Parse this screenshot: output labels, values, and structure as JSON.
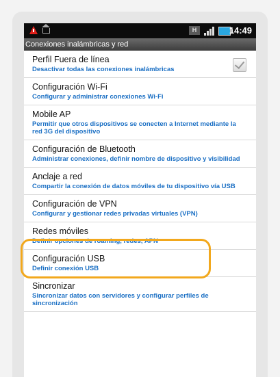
{
  "status_bar": {
    "time": "14:49",
    "network_badge": "H"
  },
  "title_bar": {
    "title": "Conexiones inalámbricas y red"
  },
  "settings": [
    {
      "title": "Perfil Fuera de línea",
      "subtitle": "Desactivar todas las conexiones inalámbricas",
      "has_checkbox": true,
      "checked": true
    },
    {
      "title": "Configuración Wi-Fi",
      "subtitle": "Configurar y administrar conexiones Wi-Fi"
    },
    {
      "title": "Mobile AP",
      "subtitle": "Permitir que otros dispositivos se conecten a Internet mediante la red 3G del dispositivo"
    },
    {
      "title": "Configuración de Bluetooth",
      "subtitle": "Administrar conexiones, definir nombre de dispositivo y visibilidad"
    },
    {
      "title": "Anclaje a red",
      "subtitle": "Compartir la conexión de datos móviles de tu dispositivo vía USB"
    },
    {
      "title": "Configuración de VPN",
      "subtitle": "Configurar y gestionar redes privadas virtuales (VPN)"
    },
    {
      "title": "Redes móviles",
      "subtitle": "Definir opciones de roaming, redes, APN",
      "highlighted": true
    },
    {
      "title": "Configuración USB",
      "subtitle": "Definir conexión USB"
    },
    {
      "title": "Sincronizar",
      "subtitle": "Sincronizar datos con servidores y configurar perfiles de sincronización"
    }
  ],
  "colors": {
    "highlight": "#f2a81d",
    "subtitle": "#1a6fc4",
    "status_bar": "#0c0c0c"
  },
  "icons": [
    "warning-icon",
    "home-icon",
    "network-type-icon",
    "signal-icon",
    "battery-icon",
    "checkbox-checked"
  ]
}
